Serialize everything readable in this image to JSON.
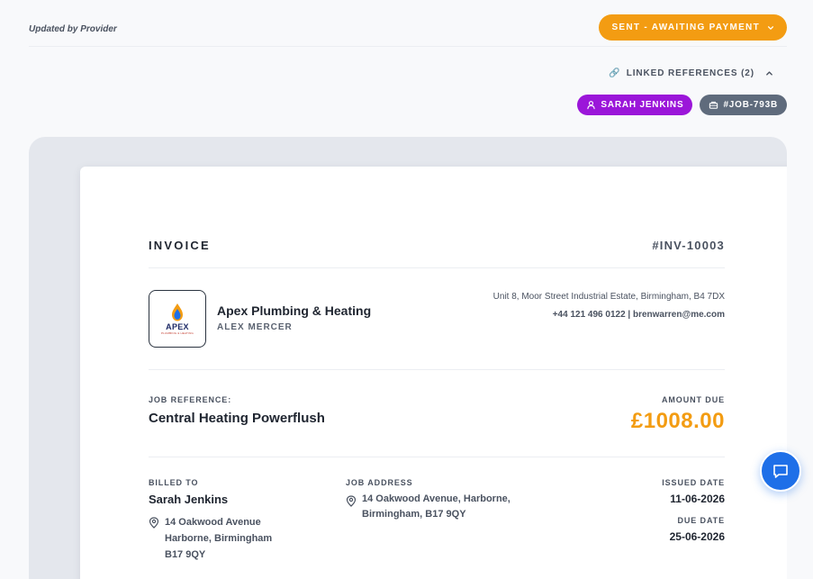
{
  "header": {
    "updated_text": "Updated by Provider",
    "status_label": "SENT - AWAITING PAYMENT",
    "status_color": "#f39c12"
  },
  "linked": {
    "label": "LINKED REFERENCES (2)",
    "icon": "🔗",
    "pills": [
      {
        "label": "SARAH JENKINS",
        "icon": "person-icon",
        "color": "#9b16d9"
      },
      {
        "label": "#JOB-793B",
        "icon": "briefcase-icon",
        "color": "#5f6b7c"
      }
    ]
  },
  "invoice": {
    "title": "INVOICE",
    "number": "#INV-10003",
    "company": {
      "logo_text": "APEX",
      "logo_sub": "PLUMBING & HEATING",
      "name": "Apex Plumbing & Heating",
      "person": "ALEX MERCER",
      "address": "Unit 8, Moor Street Industrial Estate, Birmingham, B4 7DX",
      "contact": "+44 121 496 0122 | brenwarren@me.com"
    },
    "job": {
      "label": "JOB REFERENCE:",
      "title": "Central Heating Powerflush"
    },
    "amount": {
      "label": "AMOUNT DUE",
      "value": "£1008.00",
      "color": "#f39c12"
    },
    "billed": {
      "label": "BILLED TO",
      "name": "Sarah Jenkins",
      "address_line1": "14 Oakwood Avenue",
      "address_line2": "Harborne, Birmingham",
      "address_line3": "B17 9QY"
    },
    "job_address": {
      "label": "JOB ADDRESS",
      "line1": "14 Oakwood Avenue, Harborne,",
      "line2": "Birmingham, B17 9QY"
    },
    "issued": {
      "label": "ISSUED DATE",
      "value": "11-06-2026"
    },
    "due": {
      "label": "DUE DATE",
      "value": "25-06-2026"
    }
  },
  "chat": {
    "icon": "chat-icon",
    "color": "#1e6fe8"
  }
}
